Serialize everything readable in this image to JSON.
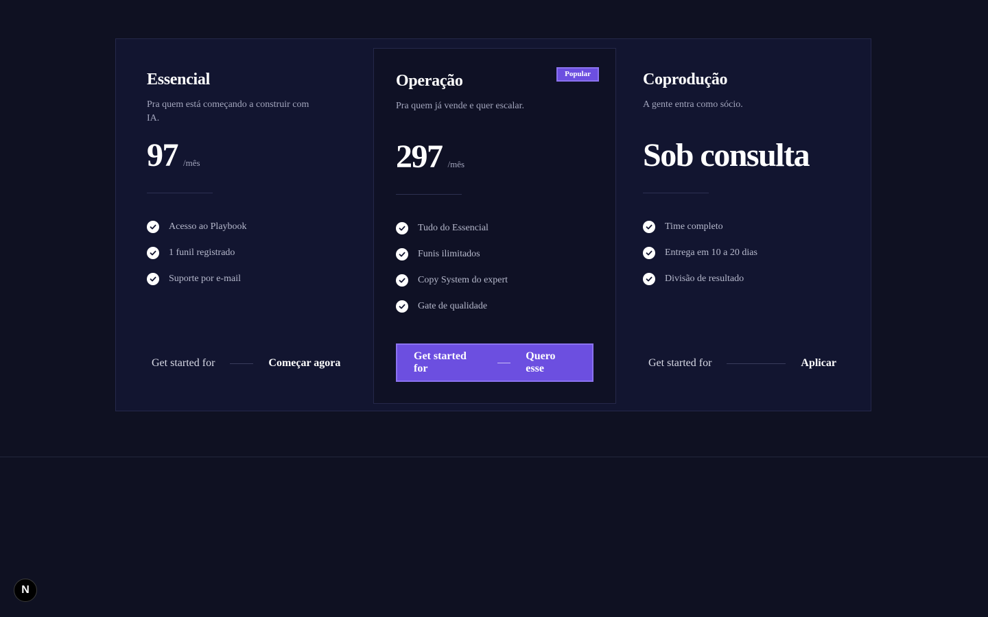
{
  "plans": [
    {
      "name": "Essencial",
      "description": "Pra quem está começando a construir com IA.",
      "price": "97",
      "period": "/mês",
      "features": [
        "Acesso ao Playbook",
        "1 funil registrado",
        "Suporte por e-mail"
      ],
      "cta_lead": "Get started for",
      "cta_action": "Começar agora"
    },
    {
      "name": "Operação",
      "badge": "Popular",
      "description": "Pra quem já vende e quer escalar.",
      "price": "297",
      "period": "/mês",
      "features": [
        "Tudo do Essencial",
        "Funis ilimitados",
        "Copy System do expert",
        "Gate de qualidade"
      ],
      "cta_lead": "Get started for",
      "cta_action": "Quero esse"
    },
    {
      "name": "Coprodução",
      "description": "A gente entra como sócio.",
      "price": "Sob consulta",
      "features": [
        "Time completo",
        "Entrega em 10 a 20 dias",
        "Divisão de resultado"
      ],
      "cta_lead": "Get started for",
      "cta_action": "Aplicar"
    }
  ],
  "colors": {
    "background": "#0f1122",
    "accent": "#6c4fe0",
    "muted_text": "#a3a6bd"
  },
  "dev_indicator": {
    "label": "N",
    "icon": "nextjs-logo-icon"
  }
}
